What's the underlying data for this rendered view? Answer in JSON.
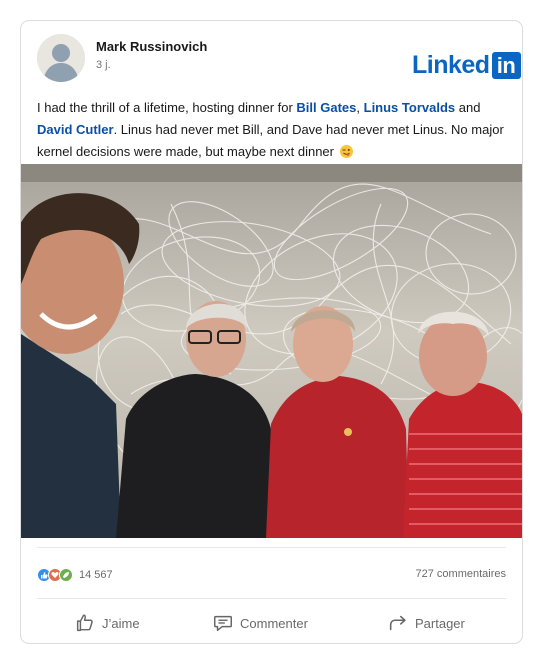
{
  "post": {
    "author_name": "Mark Russinovich",
    "time": "3 j.",
    "brand": {
      "text": "Linked",
      "box": "in",
      "color": "#0a66c2"
    },
    "text_part1": "I had the thrill of a lifetime, hosting dinner for ",
    "mention1": "Bill Gates",
    "sep1": ", ",
    "mention2": "Linus Torvalds",
    "text_part2": " and ",
    "mention3": "David Cutler",
    "text_part3": ". Linus had never met Bill, and Dave had never met Linus. No major kernel decisions were made, but maybe next dinner",
    "emoji": "winking-face-with-tongue-emoji",
    "image": "photo-four-men-posing-in-front-of-wire-scribble-art-wall"
  },
  "social": {
    "reaction_icons": [
      "like-icon",
      "love-icon",
      "support-icon"
    ],
    "reaction_count": "14 567",
    "comments": "727 commentaires"
  },
  "actions": {
    "like": "J’aime",
    "comment": "Commenter",
    "share": "Partager"
  },
  "colors": {
    "mention": "#0a4fa6",
    "like": "#378fe9",
    "love": "#df704d",
    "support": "#6dae4f"
  }
}
